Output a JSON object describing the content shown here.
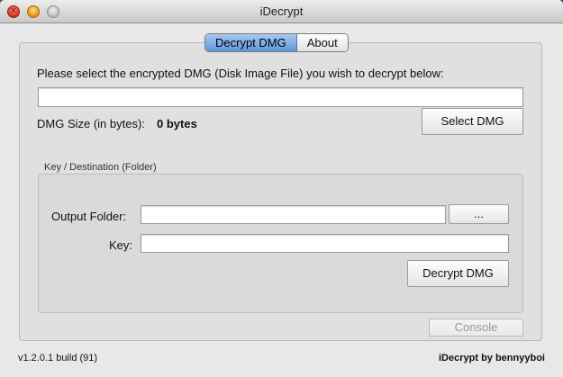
{
  "window": {
    "title": "iDecrypt"
  },
  "tabs": [
    {
      "label": "Decrypt DMG",
      "active": true
    },
    {
      "label": "About",
      "active": false
    }
  ],
  "decrypt": {
    "prompt": "Please select the encrypted DMG (Disk Image File) you wish to decrypt below:",
    "dmg_path_value": "",
    "size_label": "DMG Size (in bytes):",
    "size_value": "0 bytes",
    "select_button": "Select DMG"
  },
  "group": {
    "title": "Key / Destination (Folder)",
    "output_label": "Output Folder:",
    "output_value": "",
    "browse_button": "...",
    "key_label": "Key:",
    "key_value": "",
    "decrypt_button": "Decrypt DMG"
  },
  "console_button": "Console",
  "footer": {
    "version": "v1.2.0.1 build (91)",
    "credit": "iDecrypt by bennyyboi"
  },
  "colors": {
    "active_tab": "#5d97dc",
    "close": "#d42b1a",
    "minimize": "#e0950f",
    "zoom": "#bdbdbd"
  }
}
